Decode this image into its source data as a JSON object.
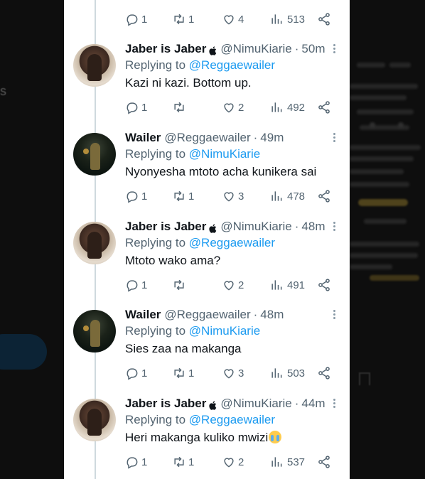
{
  "background": {
    "left_letter": "s"
  },
  "top_actions": {
    "reply": "1",
    "retweet": "1",
    "like": "4",
    "views": "513"
  },
  "tweets": [
    {
      "name": "Jaber is Jaber",
      "handle": "@NimuKiarie",
      "time": "50m",
      "replying_prefix": "Replying to",
      "replying_to": "@Reggaewailer",
      "text": "Kazi ni kazi. Bottom up.",
      "reply": "1",
      "retweet": "",
      "like": "2",
      "views": "492"
    },
    {
      "name": "Wailer",
      "handle": "@Reggaewailer",
      "time": "49m",
      "replying_prefix": "Replying to",
      "replying_to": "@NimuKiarie",
      "text": "Nyonyesha mtoto acha kunikera sai",
      "reply": "1",
      "retweet": "1",
      "like": "3",
      "views": "478"
    },
    {
      "name": "Jaber is Jaber",
      "handle": "@NimuKiarie",
      "time": "48m",
      "replying_prefix": "Replying to",
      "replying_to": "@Reggaewailer",
      "text": "Mtoto wako ama?",
      "reply": "1",
      "retweet": "",
      "like": "2",
      "views": "491"
    },
    {
      "name": "Wailer",
      "handle": "@Reggaewailer",
      "time": "48m",
      "replying_prefix": "Replying to",
      "replying_to": "@NimuKiarie",
      "text": "Sies zaa na makanga",
      "reply": "1",
      "retweet": "1",
      "like": "3",
      "views": "503"
    },
    {
      "name": "Jaber is Jaber",
      "handle": "@NimuKiarie",
      "time": "44m",
      "replying_prefix": "Replying to",
      "replying_to": "@Reggaewailer",
      "text": "Heri makanga kuliko mwizi",
      "reply": "1",
      "retweet": "1",
      "like": "2",
      "views": "537"
    }
  ],
  "separator": "·",
  "icons": [
    "reply-icon",
    "retweet-icon",
    "like-icon",
    "views-icon",
    "share-icon",
    "apple-icon",
    "more-icon",
    "crying-emoji-icon"
  ],
  "colors": {
    "link": "#1d9bf0",
    "muted": "#536471",
    "text": "#0f1419",
    "backdrop": "#0e0e0e"
  }
}
